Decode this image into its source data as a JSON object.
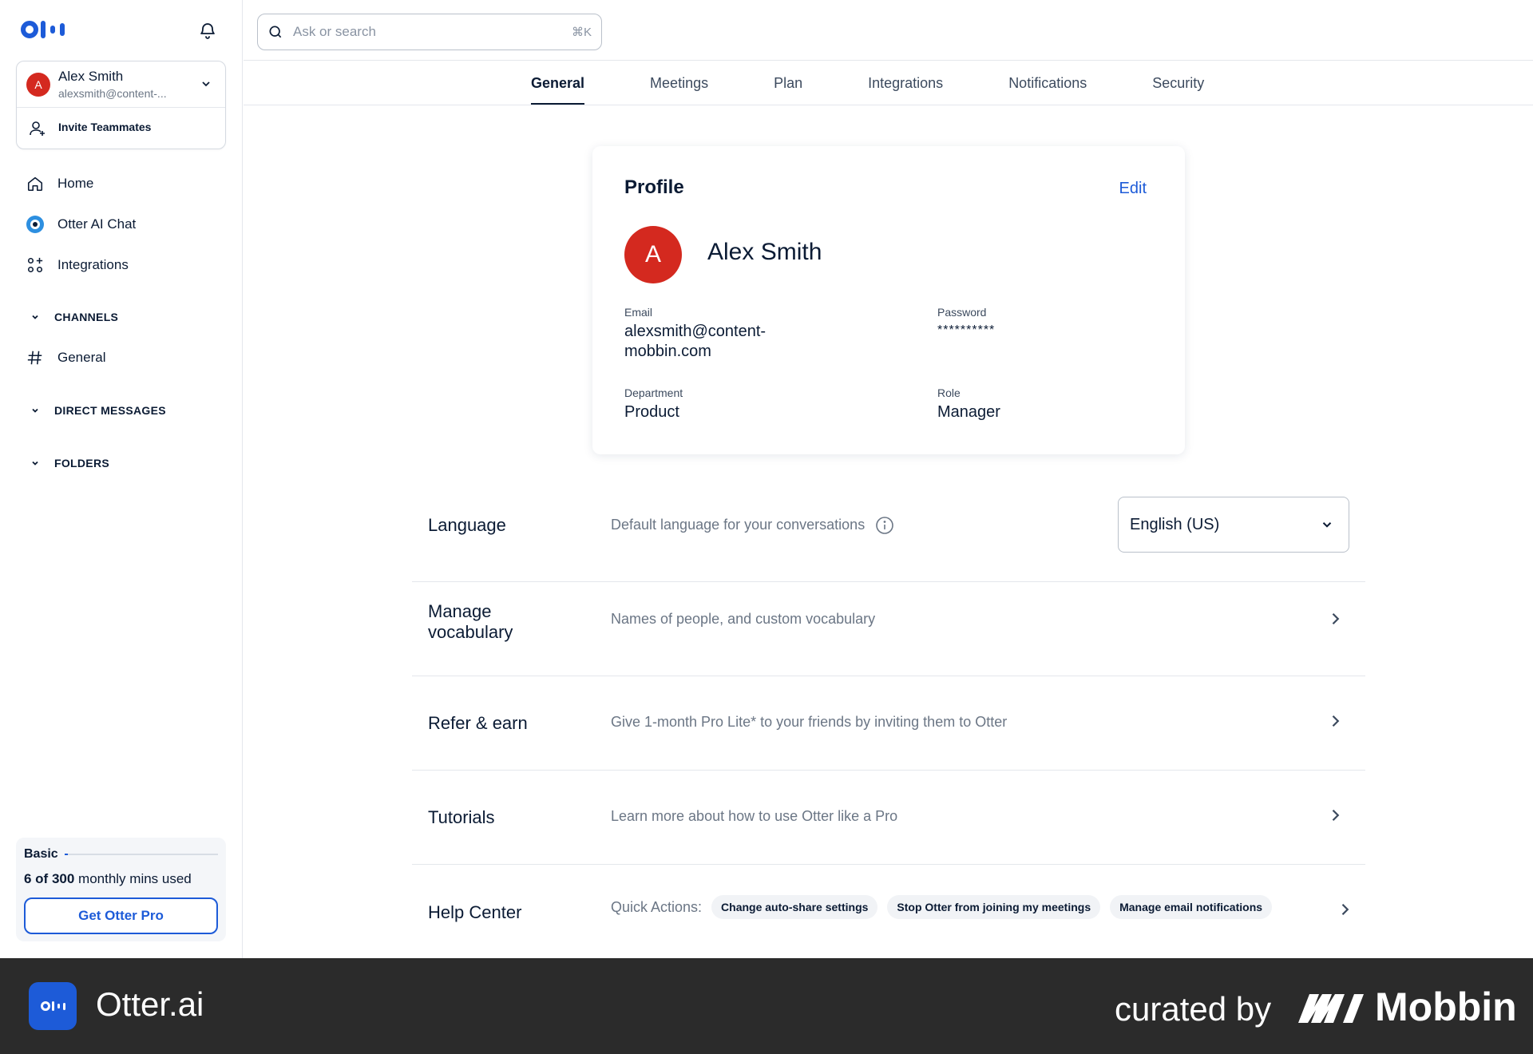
{
  "sidebar": {
    "account": {
      "initial": "A",
      "name": "Alex Smith",
      "email": "alexsmith@content-..."
    },
    "invite_label": "Invite Teammates",
    "nav": [
      {
        "label": "Home",
        "icon": "home-icon"
      },
      {
        "label": "Otter AI Chat",
        "icon": "otter-chat-icon"
      },
      {
        "label": "Integrations",
        "icon": "integrations-icon"
      }
    ],
    "sections": {
      "channels": "CHANNELS",
      "channel_general": "General",
      "direct_messages": "DIRECT MESSAGES",
      "folders": "FOLDERS"
    },
    "plan": {
      "name": "Basic",
      "used": "6 of 300",
      "usage_suffix": " monthly mins used",
      "used_fraction": 0.02,
      "cta": "Get Otter Pro"
    }
  },
  "search": {
    "placeholder": "Ask or search",
    "shortcut": "⌘K"
  },
  "tabs": [
    {
      "label": "General",
      "active": true
    },
    {
      "label": "Meetings"
    },
    {
      "label": "Plan"
    },
    {
      "label": "Integrations"
    },
    {
      "label": "Notifications"
    },
    {
      "label": "Security"
    }
  ],
  "profile": {
    "title": "Profile",
    "edit": "Edit",
    "initial": "A",
    "name": "Alex Smith",
    "email_label": "Email",
    "email": "alexsmith@content-mobbin.com",
    "password_label": "Password",
    "password": "**********",
    "department_label": "Department",
    "department": "Product",
    "role_label": "Role",
    "role": "Manager"
  },
  "settings": {
    "language": {
      "label": "Language",
      "desc": "Default language for your conversations",
      "value": "English (US)"
    },
    "vocabulary": {
      "label": "Manage vocabulary",
      "desc": "Names of people, and custom vocabulary"
    },
    "refer": {
      "label": "Refer & earn",
      "desc": "Give 1-month Pro Lite* to your friends by inviting them to Otter"
    },
    "tutorials": {
      "label": "Tutorials",
      "desc": "Learn more about how to use Otter like a Pro"
    },
    "help": {
      "label": "Help Center",
      "quick_label": "Quick Actions:",
      "chips": [
        "Change auto-share settings",
        "Stop Otter from joining my meetings",
        "Manage email notifications"
      ]
    }
  },
  "footer": {
    "app_name": "Otter.ai",
    "curated": "curated by",
    "brand": "Mobbin"
  },
  "colors": {
    "accent": "#1d5bd8",
    "avatar": "#d4291f",
    "text": "#0b1b34",
    "footer": "#2b2b2b"
  }
}
